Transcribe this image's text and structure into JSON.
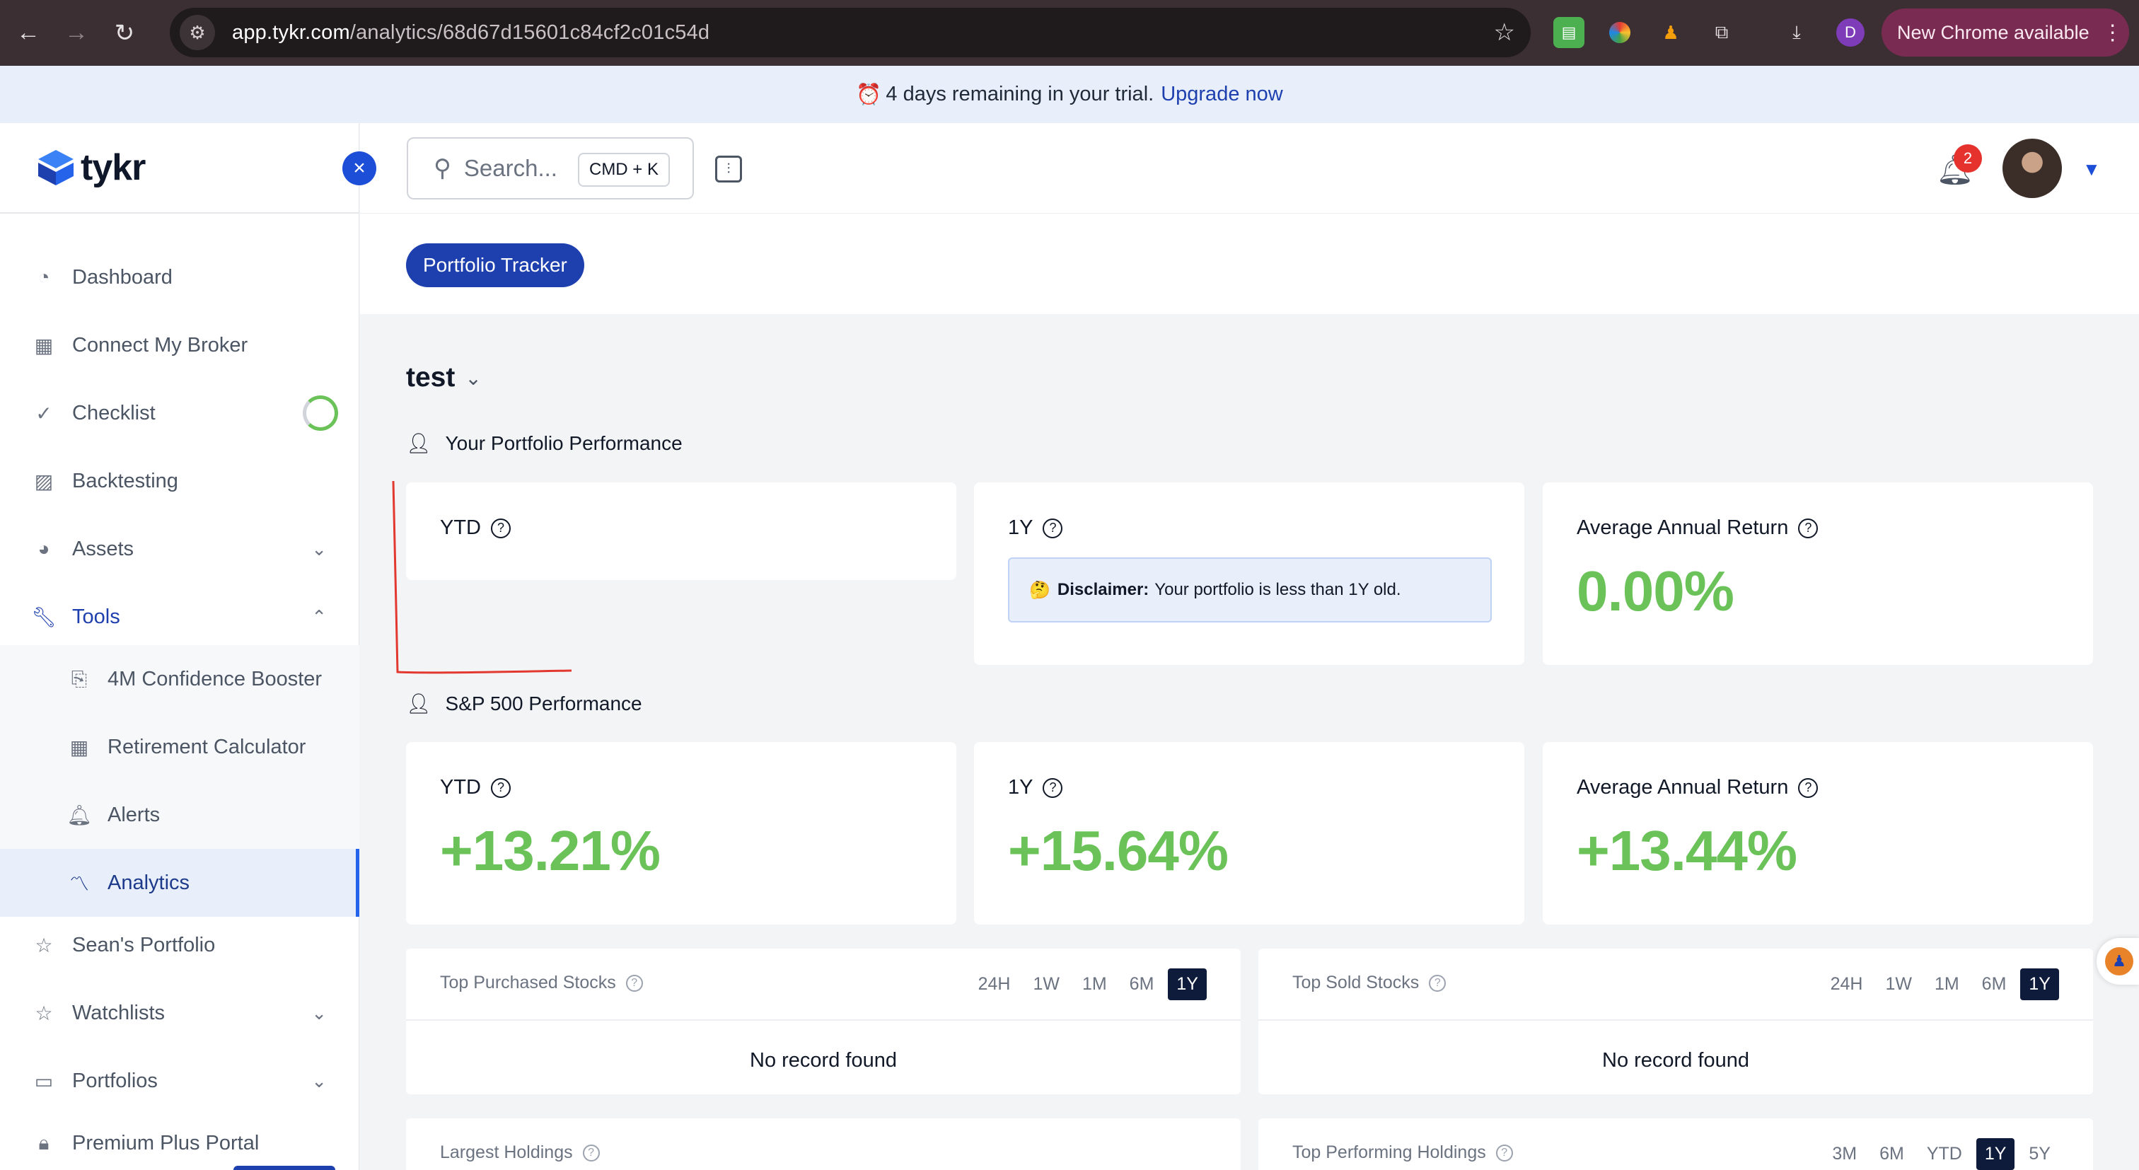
{
  "browser": {
    "url_host": "app.tykr.com",
    "url_path": "/analytics/68d67d15601c84cf2c01c54d",
    "profile_initial": "D",
    "new_chrome_label": "New Chrome available"
  },
  "trial_banner": {
    "icon": "⏰",
    "message": "4 days remaining in your trial.",
    "link": "Upgrade now"
  },
  "brand": {
    "name": "tykr"
  },
  "sidebar": {
    "items": [
      {
        "label": "Dashboard",
        "icon": "dashboard-icon"
      },
      {
        "label": "Connect My Broker",
        "icon": "broker-icon"
      },
      {
        "label": "Checklist",
        "icon": "checklist-icon"
      },
      {
        "label": "Backtesting",
        "icon": "chart-icon"
      },
      {
        "label": "Assets",
        "icon": "pie-icon"
      },
      {
        "label": "Tools",
        "icon": "wrench-icon"
      },
      {
        "label": "4M Confidence Booster",
        "icon": "booster-icon"
      },
      {
        "label": "Retirement Calculator",
        "icon": "calculator-icon"
      },
      {
        "label": "Alerts",
        "icon": "bell-icon"
      },
      {
        "label": "Analytics",
        "icon": "analytics-icon"
      },
      {
        "label": "Sean's Portfolio",
        "icon": "star-icon"
      },
      {
        "label": "Watchlists",
        "icon": "star-icon"
      },
      {
        "label": "Portfolios",
        "icon": "portfolio-icon"
      },
      {
        "label": "Premium Plus Portal",
        "icon": "lock-icon"
      }
    ]
  },
  "header": {
    "search_placeholder": "Search...",
    "search_shortcut": "CMD + K",
    "notification_count": "2"
  },
  "tabs": {
    "active": "Portfolio Tracker"
  },
  "portfolio": {
    "name": "test",
    "your_section_title": "Your Portfolio Performance",
    "sp_section_title": "S&P 500 Performance",
    "your": {
      "ytd_label": "YTD",
      "one_y_label": "1Y",
      "disclaimer_emoji": "🤔",
      "disclaimer_bold": "Disclaimer:",
      "disclaimer_text": "Your portfolio is less than 1Y old.",
      "avg_label": "Average Annual Return",
      "avg_value": "0.00%"
    },
    "sp500": {
      "ytd_label": "YTD",
      "ytd_value": "+13.21%",
      "one_y_label": "1Y",
      "one_y_value": "+15.64%",
      "avg_label": "Average Annual Return",
      "avg_value": "+13.44%"
    }
  },
  "tables": {
    "top_purchased": {
      "title": "Top Purchased Stocks",
      "ranges": [
        "24H",
        "1W",
        "1M",
        "6M",
        "1Y"
      ],
      "selected": "1Y",
      "empty": "No record found"
    },
    "top_sold": {
      "title": "Top Sold Stocks",
      "ranges": [
        "24H",
        "1W",
        "1M",
        "6M",
        "1Y"
      ],
      "selected": "1Y",
      "empty": "No record found"
    },
    "largest_holdings": {
      "title": "Largest Holdings"
    },
    "top_performing": {
      "title": "Top Performing Holdings",
      "ranges": [
        "3M",
        "6M",
        "YTD",
        "1Y",
        "5Y"
      ],
      "selected": "1Y"
    }
  },
  "colors": {
    "accent": "#1e40af",
    "positive": "#6ac259",
    "chrome_bg": "#3c2f33",
    "banner_bg": "#e8effb",
    "annotation_red": "#e2382f"
  }
}
